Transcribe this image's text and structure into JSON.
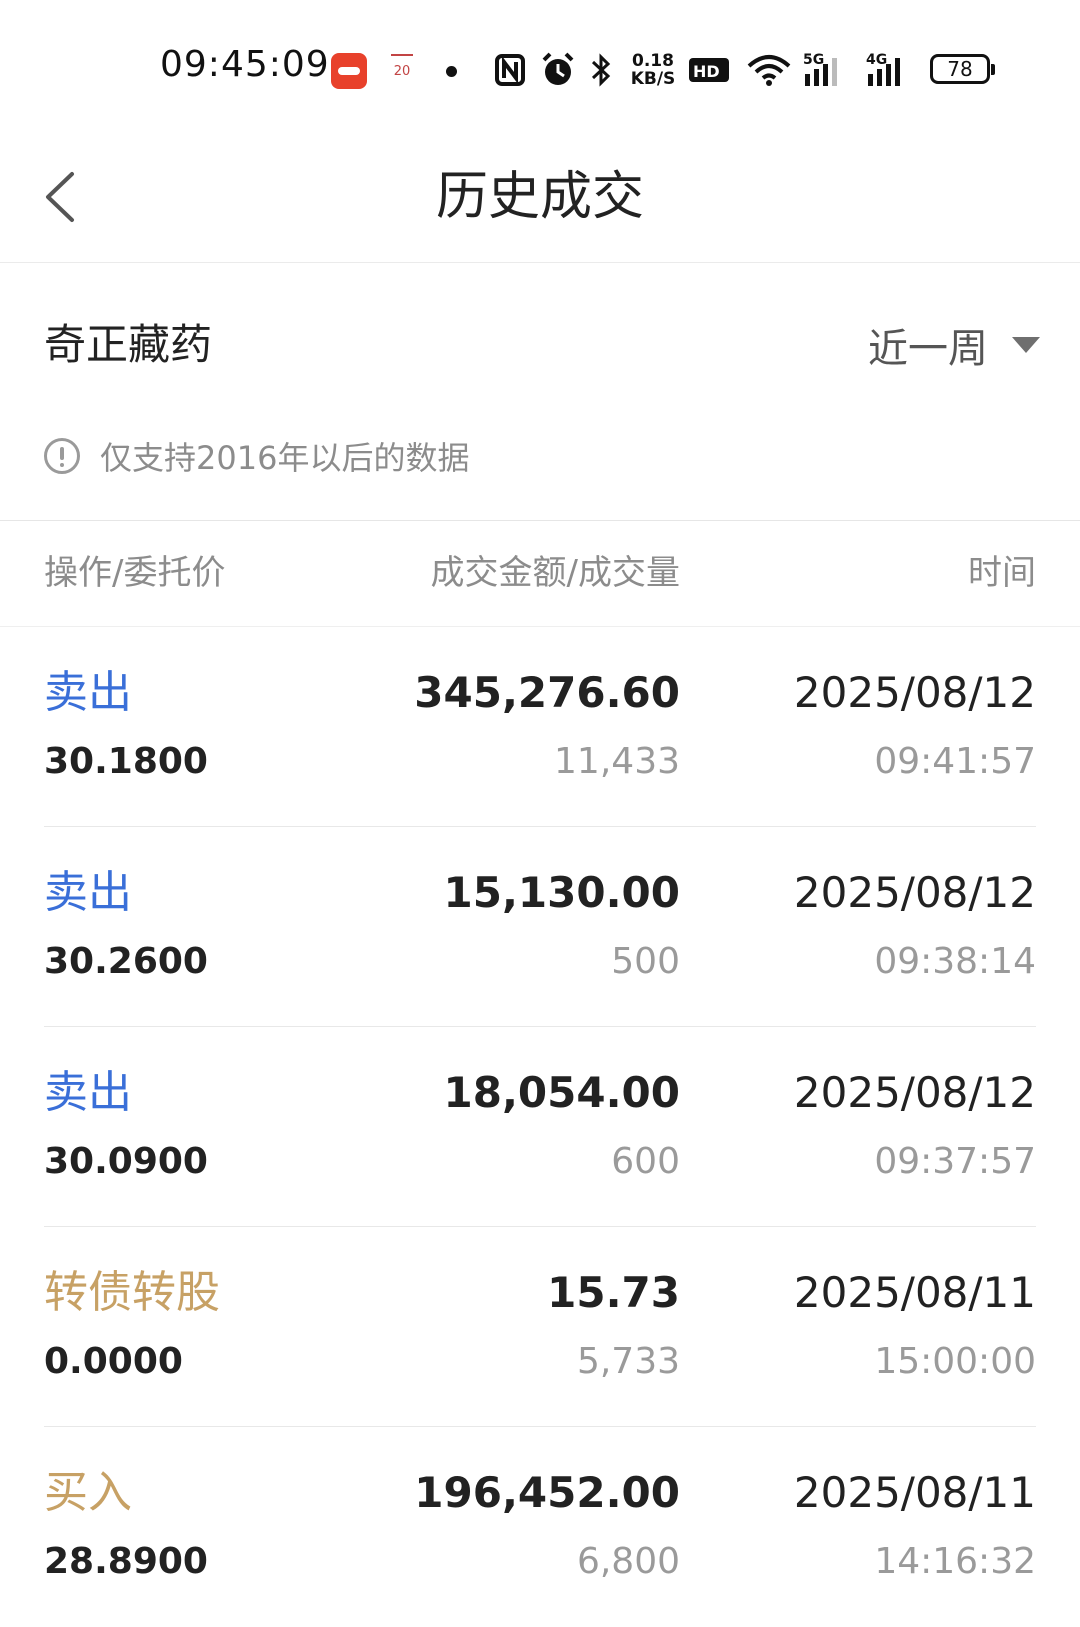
{
  "status_bar": {
    "time": "09:45:09",
    "calendar_day": "20",
    "net_speed_value": "0.18",
    "net_speed_unit": "KB/S",
    "hd_label": "HD",
    "signal_5g": "5G",
    "signal_4g": "4G",
    "battery": "78",
    "icons": [
      "app-red-icon",
      "calendar-icon",
      "dot-icon",
      "nfc-icon",
      "alarm-icon",
      "bluetooth-icon",
      "hd-icon",
      "wifi-icon",
      "signal-5g-icon",
      "signal-4g-icon",
      "battery-icon"
    ]
  },
  "nav": {
    "title": "历史成交"
  },
  "stock": {
    "name": "奇正藏药",
    "period": "近一周"
  },
  "notice": {
    "text": "仅支持2016年以后的数据"
  },
  "table": {
    "headers": {
      "action_price": "操作/委托价",
      "amount_volume": "成交金额/成交量",
      "time": "时间"
    },
    "rows": [
      {
        "action": "卖出",
        "type": "sell",
        "price": "30.1800",
        "amount": "345,276.60",
        "volume": "11,433",
        "date": "2025/08/12",
        "time": "09:41:57"
      },
      {
        "action": "卖出",
        "type": "sell",
        "price": "30.2600",
        "amount": "15,130.00",
        "volume": "500",
        "date": "2025/08/12",
        "time": "09:38:14"
      },
      {
        "action": "卖出",
        "type": "sell",
        "price": "30.0900",
        "amount": "18,054.00",
        "volume": "600",
        "date": "2025/08/12",
        "time": "09:37:57"
      },
      {
        "action": "转债转股",
        "type": "other",
        "price": "0.0000",
        "amount": "15.73",
        "volume": "5,733",
        "date": "2025/08/11",
        "time": "15:00:00"
      },
      {
        "action": "买入",
        "type": "other",
        "price": "28.8900",
        "amount": "196,452.00",
        "volume": "6,800",
        "date": "2025/08/11",
        "time": "14:16:32"
      }
    ]
  },
  "colors": {
    "sell": "#3a6fd8",
    "buy_other": "#c7a165",
    "text_primary": "#222222",
    "text_secondary": "#9a9a9a"
  }
}
